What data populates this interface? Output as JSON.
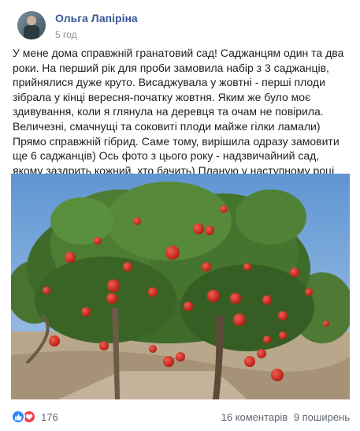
{
  "post": {
    "author": "Ольга Лапіріна",
    "time": "5 год",
    "text": "У мене дома справжній гранатовий сад! Саджанцям один та два роки. На перший рік для проби замовила набір з 3 саджанців, прийнялися дуже круто. Висаджувала у жовтні - перші плоди зібрала у кінці вересня-початку жовтня.  Яким же було моє здивування, коли я глянула на деревця та очам не повірила. Величезні, смачнущі та соковиті плоди майже гілки ламали) Прямо справжній гібрид. Саме тому, вирішила одразу замовити ще 6 саджанців) Ось фото з цього року - надзвичайний сад, якому заздрить кожний, хто бачить) Планую у наступному році вирощувати на продаж, адже урожай супер. Дякую за таку екзотику!"
  },
  "footer": {
    "reactions_count": "176",
    "comments": "16 коментарів",
    "shares": "9 поширень"
  },
  "icons": {
    "like": "like-icon",
    "love": "love-icon"
  },
  "colors": {
    "author_link": "#385898",
    "like": "#2d88ff",
    "love": "#f33e58",
    "fruit": "#d8261d"
  }
}
